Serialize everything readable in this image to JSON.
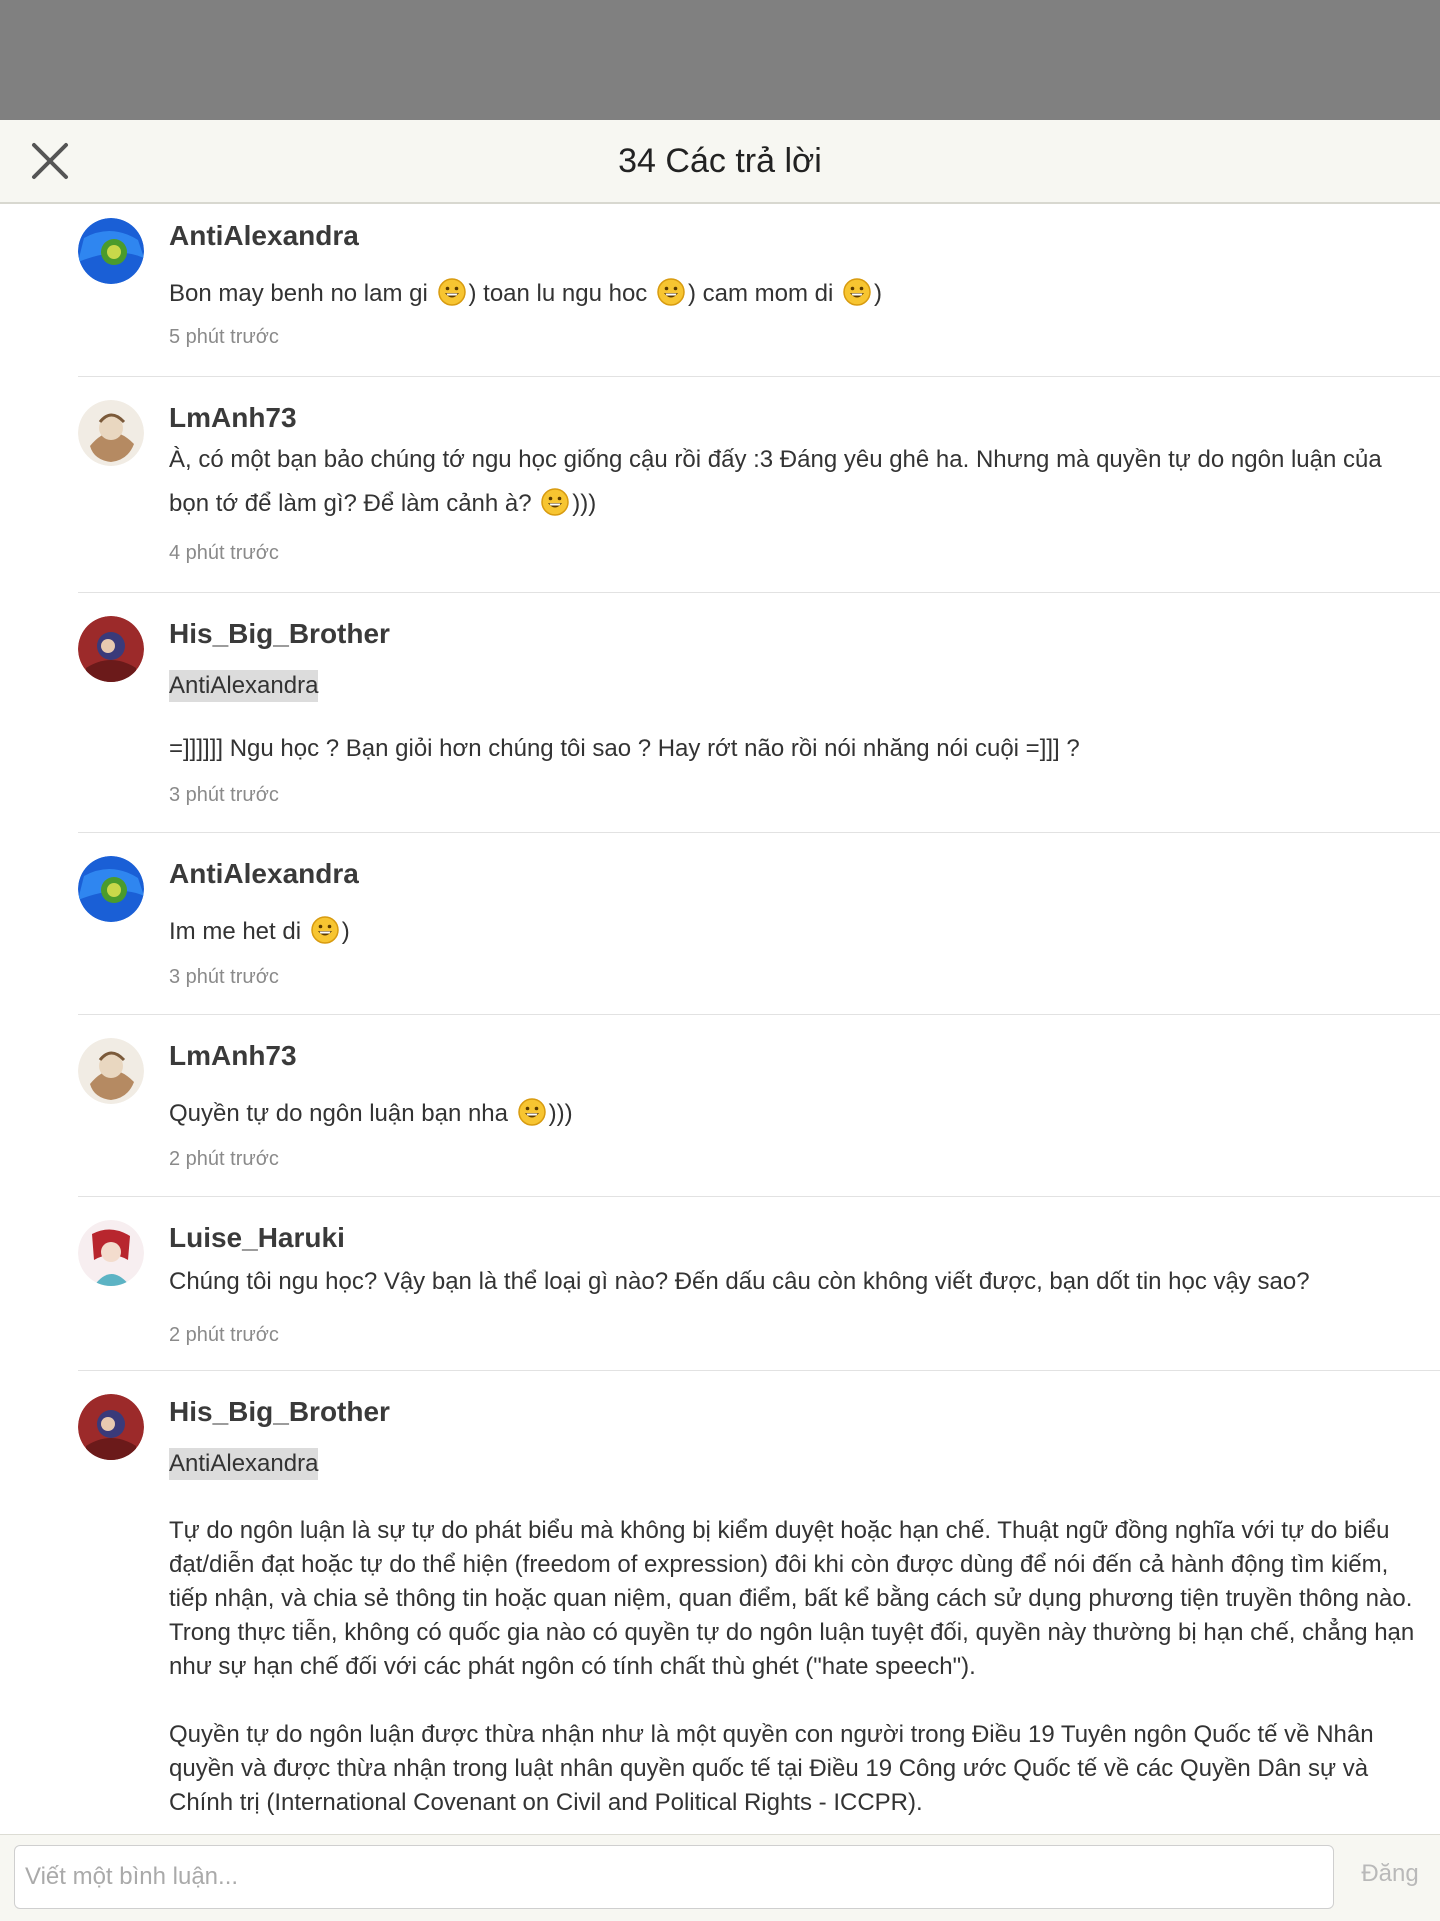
{
  "header": {
    "title": "34 Các trả lời"
  },
  "comments": [
    {
      "user": "AntiAlexandra",
      "time": "5 phút trước",
      "parts": [
        "Bon may benh no lam gi ",
        ") toan lu ngu hoc ",
        ") cam mom di ",
        ")"
      ]
    },
    {
      "user": "LmAnh73",
      "time": "4 phút trước",
      "parts": [
        "À, có một bạn bảo chúng tớ ngu học giống cậu rồi đấy :3 Đáng yêu ghê ha. Nhưng mà quyền tự do ngôn luận của bọn tớ để làm gì? Để làm cảnh à? ",
        ")))"
      ]
    },
    {
      "user": "His_Big_Brother",
      "mention": "AntiAlexandra",
      "time": "3 phút trước",
      "text": "=]]]]]] Ngu học ? Bạn giỏi hơn chúng tôi sao ? Hay rớt não rồi nói nhăng nói cuội =]]] ?"
    },
    {
      "user": "AntiAlexandra",
      "time": "3 phút trước",
      "parts": [
        "Im me het di ",
        ")"
      ]
    },
    {
      "user": "LmAnh73",
      "time": "2 phút trước",
      "parts": [
        "Quyền tự do ngôn luận bạn nha ",
        ")))"
      ]
    },
    {
      "user": "Luise_Haruki",
      "time": "2 phút trước",
      "text": "Chúng tôi ngu học? Vậy bạn là thể loại gì nào? Đến dấu câu còn không viết được, bạn dốt tin học vậy sao?"
    },
    {
      "user": "His_Big_Brother",
      "mention": "AntiAlexandra",
      "paragraphs": [
        "Tự do ngôn luận là sự tự do phát biểu mà không bị kiểm duyệt hoặc hạn chế. Thuật ngữ đồng nghĩa với tự do biểu đạt/diễn đạt hoặc tự do thể hiện (freedom of expression) đôi khi còn được dùng để nói đến cả hành động tìm kiếm, tiếp nhận, và chia sẻ thông tin hoặc quan niệm, quan điểm, bất kể bằng cách sử dụng phương tiện truyền thông nào. Trong thực tiễn, không có quốc gia nào có quyền tự do ngôn luận tuyệt đối, quyền này thường bị hạn chế, chẳng hạn như sự hạn chế đối với các phát ngôn có tính chất thù ghét (\"hate speech\").",
        "Quyền tự do ngôn luận được thừa nhận như là một quyền con người trong Điều 19 Tuyên ngôn Quốc tế về Nhân quyền và được thừa nhận trong luật nhân quyền quốc tế tại Điều 19 Công ước Quốc tế về các Quyền Dân sự và Chính trị (International Covenant on Civil and Political Rights - ICCPR)."
      ]
    }
  ],
  "footer": {
    "placeholder": "Viết một bình luận...",
    "post_label": "Đăng"
  },
  "icons": {
    "close": "close-icon",
    "emoji": "grinning-face-emoji",
    "avatar": "user-avatar"
  },
  "colors": {
    "overlay": "#808080",
    "header_bg": "#f7f7f2",
    "mention_bg": "#dcdcdc",
    "muted": "#8a8a8a"
  }
}
